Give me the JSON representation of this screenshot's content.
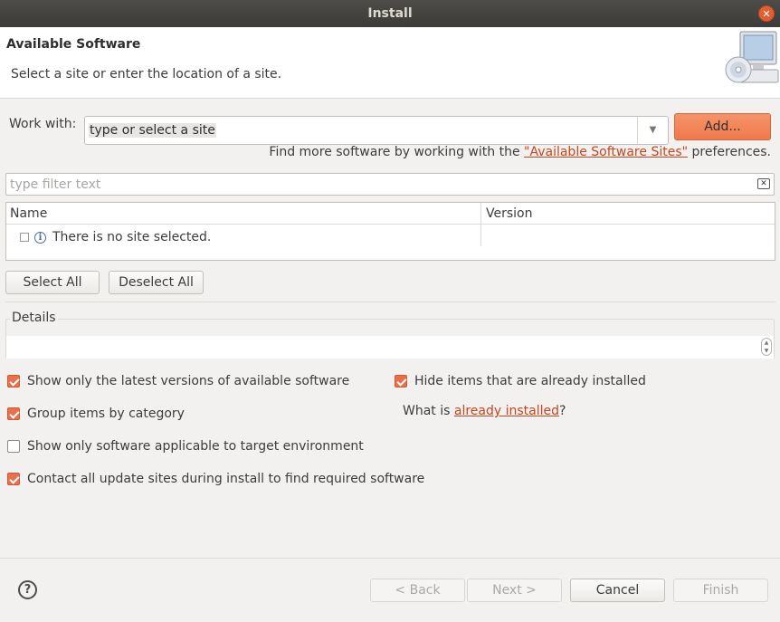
{
  "window": {
    "title": "Install"
  },
  "header": {
    "title": "Available Software",
    "subtitle": "Select a site or enter the location of a site."
  },
  "work_with": {
    "label": "Work with:",
    "value": "type or select a site",
    "add_label": "Add...",
    "find_more_prefix": "Find more software by working with the ",
    "find_more_link": "\"Available Software Sites\"",
    "find_more_suffix": " preferences."
  },
  "filter": {
    "placeholder": "type filter text"
  },
  "table": {
    "columns": [
      "Name",
      "Version"
    ],
    "rows": [
      {
        "name": "There is no site selected.",
        "version": ""
      }
    ]
  },
  "buttons": {
    "select_all": "Select All",
    "deselect_all": "Deselect All"
  },
  "details": {
    "label": "Details"
  },
  "options": {
    "latest_versions": {
      "label": "Show only the latest versions of available software",
      "checked": true
    },
    "hide_installed": {
      "label": "Hide items that are already installed",
      "checked": true
    },
    "group_by_category": {
      "label": "Group items by category",
      "checked": true
    },
    "target_env": {
      "label": "Show only software applicable to target environment",
      "checked": false
    },
    "contact_sites": {
      "label": "Contact all update sites during install to find required software",
      "checked": true
    }
  },
  "what_is": {
    "prefix": "What is ",
    "link": "already installed",
    "suffix": "?"
  },
  "footer": {
    "help_symbol": "?",
    "back": "< Back",
    "next": "Next >",
    "cancel": "Cancel",
    "finish": "Finish"
  },
  "colors": {
    "accent": "#e9704a",
    "link": "#c6461e",
    "titlebar": "#3c3b37"
  },
  "icons": [
    "close-icon",
    "software-banner-icon",
    "dropdown-arrow-icon",
    "clear-filter-icon",
    "info-icon",
    "help-icon"
  ]
}
